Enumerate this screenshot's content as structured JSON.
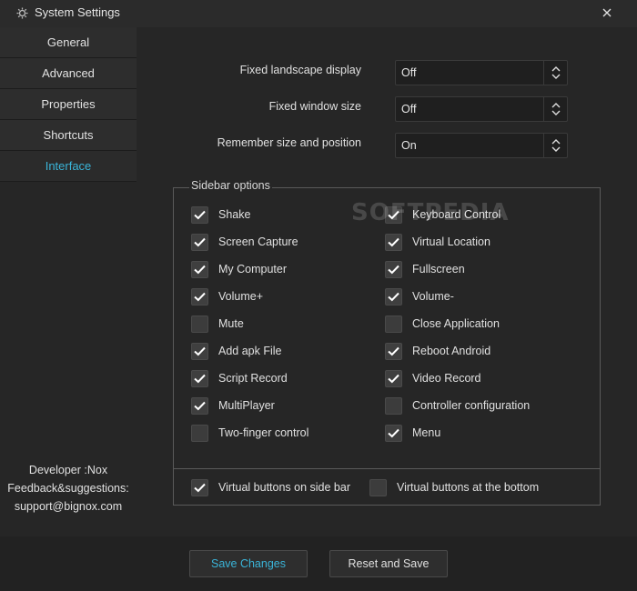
{
  "window": {
    "title": "System Settings"
  },
  "sidebar": {
    "items": [
      {
        "label": "General"
      },
      {
        "label": "Advanced"
      },
      {
        "label": "Properties"
      },
      {
        "label": "Shortcuts"
      },
      {
        "label": "Interface"
      }
    ],
    "active_index": 4,
    "developer": "Developer :Nox",
    "feedback": "Feedback&suggestions:",
    "email": "support@bignox.com"
  },
  "settings": [
    {
      "label": "Fixed landscape display",
      "value": "Off"
    },
    {
      "label": "Fixed window size",
      "value": "Off"
    },
    {
      "label": "Remember size and position",
      "value": "On"
    }
  ],
  "sidebar_options": {
    "title": "Sidebar options",
    "left": [
      {
        "label": "Shake",
        "checked": true
      },
      {
        "label": "Screen Capture",
        "checked": true
      },
      {
        "label": "My Computer",
        "checked": true
      },
      {
        "label": "Volume+",
        "checked": true
      },
      {
        "label": "Mute",
        "checked": false
      },
      {
        "label": "Add apk File",
        "checked": true
      },
      {
        "label": "Script Record",
        "checked": true
      },
      {
        "label": "MultiPlayer",
        "checked": true
      },
      {
        "label": "Two-finger control",
        "checked": false
      }
    ],
    "right": [
      {
        "label": "Keyboard Control",
        "checked": true
      },
      {
        "label": "Virtual Location",
        "checked": true
      },
      {
        "label": "Fullscreen",
        "checked": true
      },
      {
        "label": "Volume-",
        "checked": true
      },
      {
        "label": "Close Application",
        "checked": false
      },
      {
        "label": "Reboot Android",
        "checked": true
      },
      {
        "label": "Video Record",
        "checked": true
      },
      {
        "label": "Controller configuration",
        "checked": false
      },
      {
        "label": "Menu",
        "checked": true
      }
    ],
    "bottom": [
      {
        "label": "Virtual buttons on side bar",
        "checked": true
      },
      {
        "label": "Virtual buttons at the bottom",
        "checked": false
      }
    ]
  },
  "watermark": "SOFTPEDIA",
  "buttons": {
    "save": "Save Changes",
    "reset": "Reset and Save"
  },
  "colors": {
    "accent": "#3ab4d8",
    "background": "#262626"
  }
}
